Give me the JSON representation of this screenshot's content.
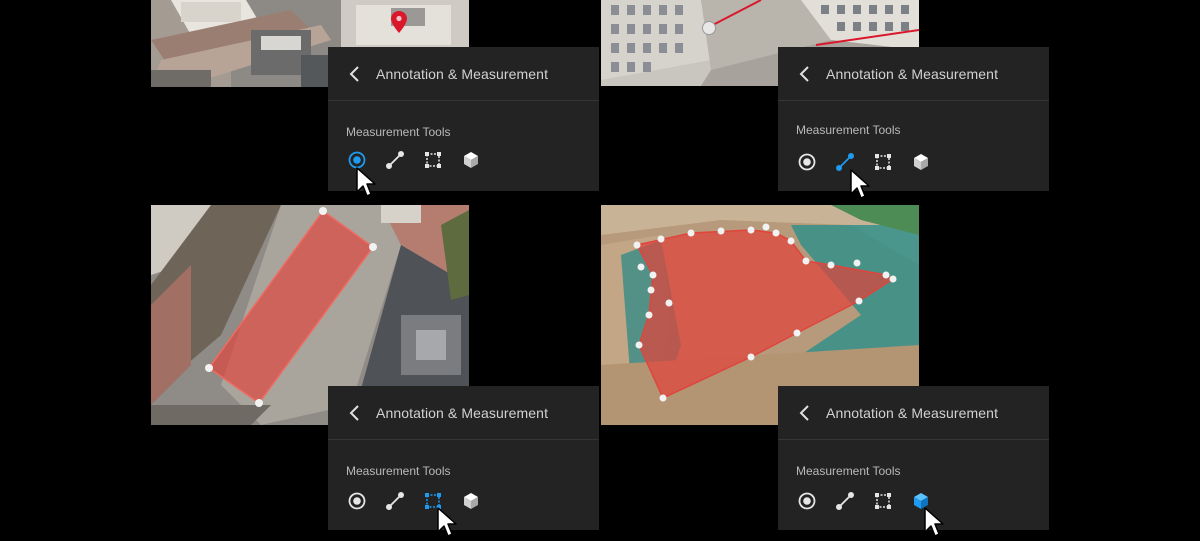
{
  "panels": [
    {
      "title": "Annotation & Measurement",
      "section_label": "Measurement Tools",
      "active_tool": "point"
    },
    {
      "title": "Annotation & Measurement",
      "section_label": "Measurement Tools",
      "active_tool": "distance"
    },
    {
      "title": "Annotation & Measurement",
      "section_label": "Measurement Tools",
      "active_tool": "area"
    },
    {
      "title": "Annotation & Measurement",
      "section_label": "Measurement Tools",
      "active_tool": "volume"
    }
  ],
  "tools": [
    "point-measure-icon",
    "distance-measure-icon",
    "area-measure-icon",
    "volume-measure-icon"
  ],
  "colors": {
    "accent": "#1e9bf0",
    "panel_bg": "#232323",
    "icon": "#e6e6e6",
    "measure_fill": "#e0443c",
    "marker_red": "#d9182c"
  }
}
